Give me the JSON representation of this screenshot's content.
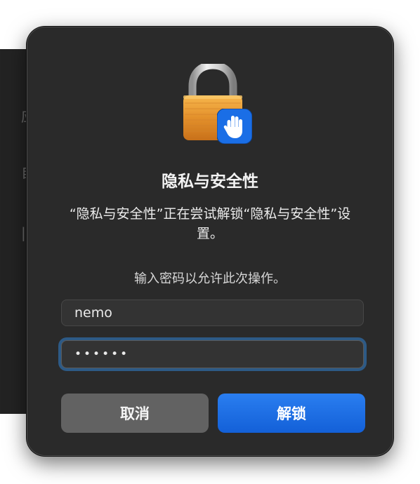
{
  "dialog": {
    "title": "隐私与安全性",
    "message": "“隐私与安全性”正在尝试解锁“隐私与安全性”设置。",
    "prompt": "输入密码以允许此次操作。",
    "username": {
      "value": "nemo",
      "placeholder": ""
    },
    "password": {
      "value": "••••••"
    },
    "cancel_label": "取消",
    "unlock_label": "解锁"
  },
  "icons": {
    "lock": "lock-icon",
    "privacy_hand": "raised-hand-icon"
  },
  "colors": {
    "dialog_bg": "#2a2a2a",
    "accent": "#1a6ee6",
    "focus_ring": "#2d5a86",
    "cancel_bg": "#626262",
    "lock_gold": "#e79a33"
  },
  "background_window": {
    "glyphs": [
      "应",
      "自",
      "|"
    ]
  }
}
